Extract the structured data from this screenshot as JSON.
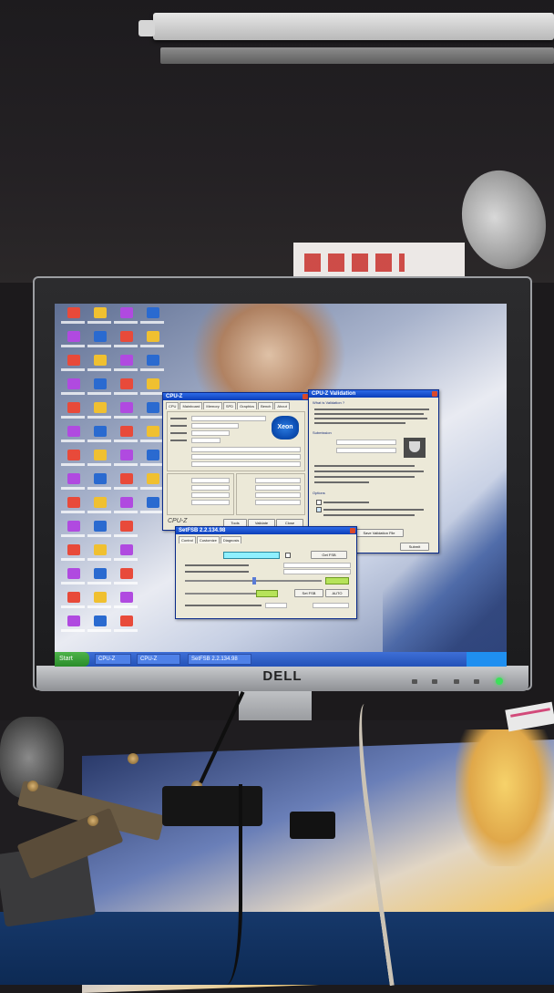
{
  "monitor": {
    "brand": "DELL"
  },
  "taskbar": {
    "start_label": "Start",
    "items": [
      "CPU-Z",
      "CPU-Z",
      "SetFSB 2.2.134.98"
    ]
  },
  "cpuz_window": {
    "title": "CPU-Z",
    "tabs": [
      "CPU",
      "Mainboard",
      "Memory",
      "SPD",
      "Graphics",
      "Bench",
      "About"
    ],
    "brand_badge": "Xeon",
    "footer_brand": "CPU-Z",
    "buttons": [
      "Tools",
      "Validate",
      "Close"
    ]
  },
  "validation_window": {
    "title": "CPU-Z Validation",
    "section_titles": [
      "What is Validation ?",
      "Submission",
      "Options"
    ],
    "button": "Save Validation File",
    "submit": "Submit"
  },
  "setfsb_window": {
    "title": "SetFSB 2.2.134.98",
    "tabs": [
      "Control",
      "Customize",
      "Diagnosis"
    ],
    "button_get_fsb": "Get FSB",
    "button_set_fsb": "Set FSB",
    "button_auto": "AUTO"
  },
  "colors": {
    "taskbar": "#2452b8",
    "start_button": "#2a8c2a",
    "power_led": "#3ce05a",
    "xeon_badge": "#0d4fb4"
  }
}
